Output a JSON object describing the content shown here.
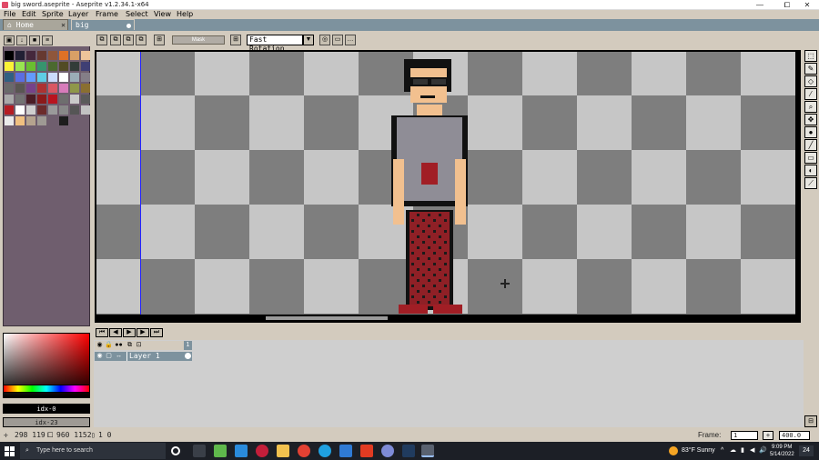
{
  "window": {
    "title": "big sword.aseprite - Aseprite v1.2.34.1-x64",
    "minimize": "—",
    "maximize": "⧠",
    "close": "✕"
  },
  "menu": [
    "File",
    "Edit",
    "Sprite",
    "Layer",
    "Frame",
    "Select",
    "View",
    "Help"
  ],
  "tabs": [
    {
      "label": "Home",
      "close": "✕"
    },
    {
      "label": "big sword.asepi"
    }
  ],
  "toolbar": {
    "rotation_mode": "Fast Rotation",
    "transparent_label": "Mask"
  },
  "layers": {
    "layer_name": "Layer 1",
    "frame_number": "1"
  },
  "color": {
    "fg_index": "idx-0",
    "bg_index": "idx-23"
  },
  "status": {
    "cursor": "298  119",
    "size": "960  1152",
    "frame_info": "1  0",
    "frame_label": "Frame:",
    "frame_value": "1",
    "zoom": "400.0"
  },
  "taskbar": {
    "search_placeholder": "Type here to search",
    "weather": "83°F  Sunny",
    "time": "9:09 PM",
    "date": "5/14/2022",
    "notifications": "24"
  },
  "colors": {
    "accent": "#7d929e",
    "ui_bg": "#d3cbbe",
    "sidebar": "#6f5e6e"
  }
}
